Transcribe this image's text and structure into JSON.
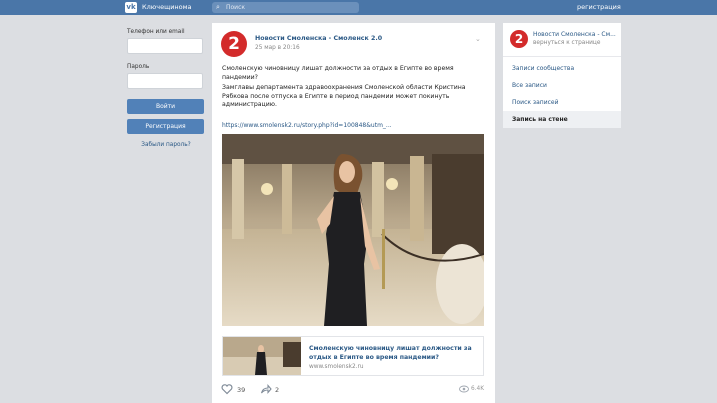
{
  "header": {
    "logo": "vk",
    "brand": "Ключещинома",
    "search_placeholder": "Поиск",
    "register": "регистрация"
  },
  "login": {
    "phone_label": "Телефон или email",
    "password_label": "Пароль",
    "login_button": "Войти",
    "register_button": "Регистрация",
    "forgot_link": "Забыли пароль?"
  },
  "post": {
    "avatar_text": "2",
    "group_name": "Новости Смоленска - Смоленск 2.0",
    "date": "25 мар в 20:16",
    "text_1": "Смоленскую чиновницу лишат должности за отдых в Египте во время пандемии?",
    "text_2": "Замглавы департамента здравоохранения Смоленской области Кристина Рябкова после отпуска в Египте в период пандемии может покинуть администрацию.",
    "link": "https://www.smolensk2.ru/story.php?id=100848&utm_...",
    "card_title": "Смоленскую чиновницу лишат должности за отдых в Египте во время пандемии?",
    "card_domain": "www.smolensk2.ru",
    "likes": "39",
    "shares": "2",
    "views": "6.4K"
  },
  "sidebar": {
    "avatar_text": "2",
    "group_name": "Новости Смоленска - См...",
    "back_link": "вернуться к странице",
    "items": [
      {
        "label": "Записи сообщества",
        "active": false
      },
      {
        "label": "Все записи",
        "active": false
      },
      {
        "label": "Поиск записей",
        "active": false
      },
      {
        "label": "Запись на стене",
        "active": true
      }
    ]
  },
  "colors": {
    "header": "#4a76a8",
    "button": "#5181b8",
    "link": "#2a5885",
    "avatar": "#d32b2b",
    "background": "#dcdee2"
  }
}
